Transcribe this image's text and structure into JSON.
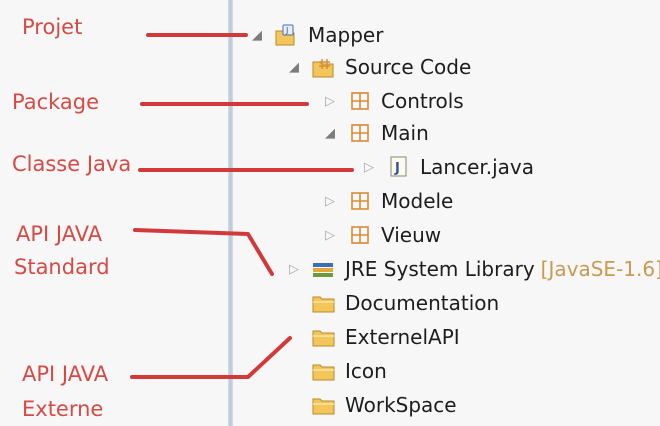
{
  "annotations": [
    {
      "id": "projet",
      "text": "Projet"
    },
    {
      "id": "package",
      "text": "Package"
    },
    {
      "id": "classe",
      "text": "Classe Java"
    },
    {
      "id": "api_std_1",
      "text": "API JAVA"
    },
    {
      "id": "api_std_2",
      "text": "Standard"
    },
    {
      "id": "api_ext_1",
      "text": "API JAVA"
    },
    {
      "id": "api_ext_2",
      "text": "Externe"
    }
  ],
  "tree": {
    "project": {
      "label": "Mapper",
      "icon": "java-project-icon"
    },
    "source": {
      "label": "Source Code",
      "icon": "source-folder-icon"
    },
    "packages": [
      {
        "label": "Controls",
        "icon": "package-icon"
      },
      {
        "label": "Main",
        "icon": "package-icon"
      },
      {
        "label": "Modele",
        "icon": "package-icon"
      },
      {
        "label": "Vieuw",
        "icon": "package-icon"
      }
    ],
    "class_file": {
      "label": "Lancer.java",
      "icon": "java-file-icon"
    },
    "jre": {
      "label": "JRE System Library",
      "decoration": "[JavaSE-1.6]",
      "icon": "library-icon"
    },
    "folders": [
      {
        "label": "Documentation",
        "icon": "folder-icon"
      },
      {
        "label": "ExternelAPI",
        "icon": "folder-icon"
      },
      {
        "label": "Icon",
        "icon": "folder-icon"
      },
      {
        "label": "WorkSpace",
        "icon": "folder-icon"
      }
    ]
  },
  "colors": {
    "annotation": "#d54a44",
    "connector": "#d23a3a",
    "folder": "#f2c65a",
    "package": "#d98b35"
  }
}
